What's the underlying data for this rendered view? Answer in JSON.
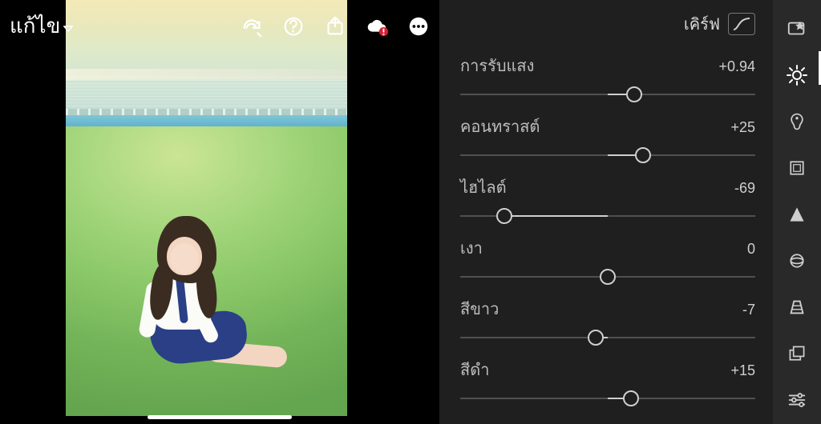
{
  "header": {
    "title": "แก้ไข"
  },
  "panel": {
    "curve_label": "เคิร์ฟ"
  },
  "sliders": [
    {
      "label": "การรับแสง",
      "value": "+0.94",
      "pos": 59
    },
    {
      "label": "คอนทราสต์",
      "value": "+25",
      "pos": 62
    },
    {
      "label": "ไฮไลต์",
      "value": "-69",
      "pos": 15
    },
    {
      "label": "เงา",
      "value": "0",
      "pos": 50
    },
    {
      "label": "สีขาว",
      "value": "-7",
      "pos": 46
    },
    {
      "label": "สีดำ",
      "value": "+15",
      "pos": 58
    }
  ],
  "toolbar_icons": {
    "redo": "redo-icon",
    "help": "help-icon",
    "share": "share-icon",
    "cloud": "cloud-alert-icon",
    "more": "more-icon"
  },
  "tool_strip": [
    "presets-icon",
    "light-icon",
    "color-icon",
    "crop-icon",
    "detail-icon",
    "optics-icon",
    "geometry-icon",
    "versions-icon",
    "tune-icon"
  ]
}
